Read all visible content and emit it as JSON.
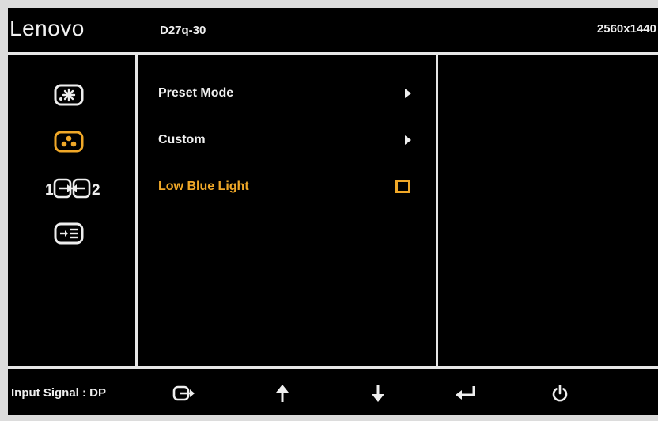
{
  "header": {
    "brand": "Lenovo",
    "model": "D27q-30",
    "resolution": "2560x1440"
  },
  "sidebar": {
    "categories": [
      {
        "icon": "brightness-contrast-icon",
        "selected": false
      },
      {
        "icon": "color-settings-icon",
        "selected": true
      },
      {
        "icon": "input-source-icon",
        "selected": false
      },
      {
        "icon": "menu-settings-icon",
        "selected": false
      }
    ]
  },
  "menu": {
    "items": [
      {
        "label": "Preset Mode",
        "control": "arrow",
        "selected": false
      },
      {
        "label": "Custom",
        "control": "arrow",
        "selected": false
      },
      {
        "label": "Low Blue Light",
        "control": "checkbox",
        "checked": false,
        "selected": true
      }
    ]
  },
  "footer": {
    "input_signal": "Input Signal : DP",
    "buttons": [
      "exit-icon",
      "up-arrow-icon",
      "down-arrow-icon",
      "enter-icon",
      "power-icon"
    ]
  },
  "colors": {
    "background": "#000000",
    "line": "#e6e6e6",
    "accent": "#f0a828",
    "text": "#f0f0f0"
  }
}
